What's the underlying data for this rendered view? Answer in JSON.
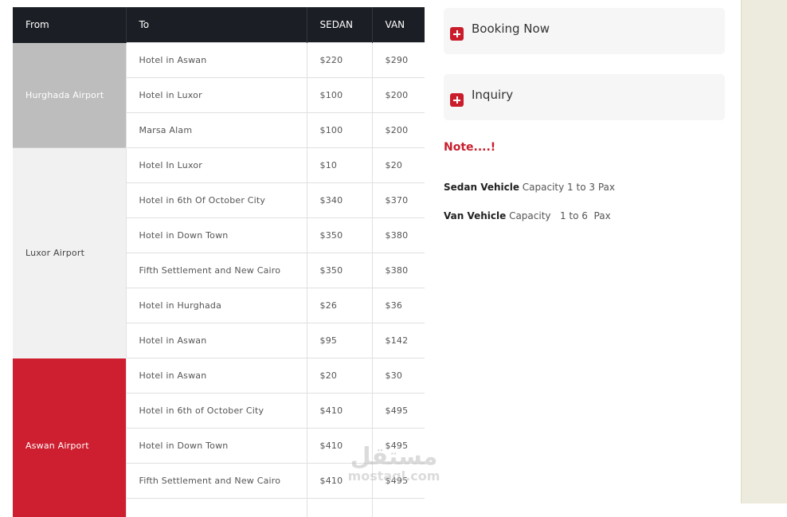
{
  "table": {
    "headers": {
      "from": "From",
      "to": "To",
      "sedan": "SEDAN",
      "van": "VAN"
    },
    "groups": [
      {
        "from": "Hurghada Airport",
        "rows": [
          {
            "to": "Hotel in Aswan",
            "sedan": "$220",
            "van": "$290"
          },
          {
            "to": "Hotel in Luxor",
            "sedan": "$100",
            "van": "$200"
          },
          {
            "to": "Marsa Alam",
            "sedan": "$100",
            "van": "$200"
          }
        ]
      },
      {
        "from": "Luxor Airport",
        "rows": [
          {
            "to": "Hotel In Luxor",
            "sedan": "$10",
            "van": "$20"
          },
          {
            "to": "Hotel in 6th Of October City",
            "sedan": "$340",
            "van": "$370"
          },
          {
            "to": "Hotel in Down Town",
            "sedan": "$350",
            "van": "$380"
          },
          {
            "to": "Fifth Settlement and New Cairo",
            "sedan": "$350",
            "van": "$380"
          },
          {
            "to": "Hotel in Hurghada",
            "sedan": "$26",
            "van": "$36"
          },
          {
            "to": "Hotel in Aswan",
            "sedan": "$95",
            "van": "$142"
          }
        ]
      },
      {
        "from": "Aswan Airport",
        "rows": [
          {
            "to": "Hotel in Aswan",
            "sedan": "$20",
            "van": "$30"
          },
          {
            "to": "Hotel in 6th of October City",
            "sedan": "$410",
            "van": "$495"
          },
          {
            "to": "Hotel in Down Town",
            "sedan": "$410",
            "van": "$495"
          },
          {
            "to": "Fifth Settlement and New Cairo",
            "sedan": "$410",
            "van": "$495"
          },
          {
            "to": "",
            "sedan": "",
            "van": ""
          }
        ]
      }
    ]
  },
  "sidebar": {
    "accordion": [
      {
        "label": "Booking Now"
      },
      {
        "label": "Inquiry"
      }
    ],
    "note_title": "Note....!",
    "capacity": [
      {
        "vehicle": "Sedan Vehicle",
        "text": " Capacity 1 to 3 Pax"
      },
      {
        "vehicle": "Van Vehicle",
        "text": " Capacity   1 to 6  Pax"
      }
    ]
  },
  "watermark": {
    "arabic": "مستقل",
    "latin": "mostaql.com"
  },
  "colors": {
    "header_bg": "#1b1e24",
    "accent_red": "#cd1f30",
    "gray_cell": "#bdbdbd",
    "light_cell": "#f1f1f1"
  }
}
